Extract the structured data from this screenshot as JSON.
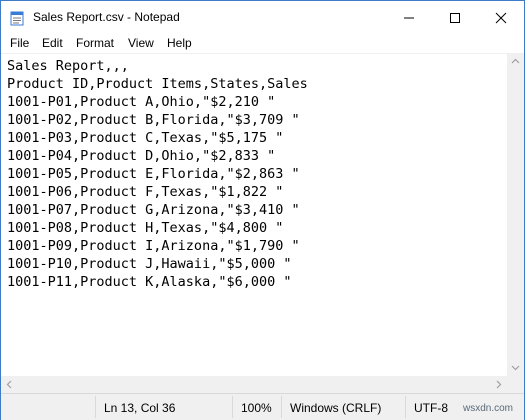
{
  "window": {
    "title": "Sales Report.csv - Notepad"
  },
  "menu": {
    "items": [
      "File",
      "Edit",
      "Format",
      "View",
      "Help"
    ]
  },
  "editor": {
    "lines": [
      "Sales Report,,,",
      "Product ID,Product Items,States,Sales",
      "1001-P01,Product A,Ohio,\"$2,210 \"",
      "1001-P02,Product B,Florida,\"$3,709 \"",
      "1001-P03,Product C,Texas,\"$5,175 \"",
      "1001-P04,Product D,Ohio,\"$2,833 \"",
      "1001-P05,Product E,Florida,\"$2,863 \"",
      "1001-P06,Product F,Texas,\"$1,822 \"",
      "1001-P07,Product G,Arizona,\"$3,410 \"",
      "1001-P08,Product H,Texas,\"$4,800 \"",
      "1001-P09,Product I,Arizona,\"$1,790 \"",
      "1001-P10,Product J,Hawaii,\"$5,000 \"",
      "1001-P11,Product K,Alaska,\"$6,000 \""
    ]
  },
  "status": {
    "position": "Ln 13, Col 36",
    "zoom": "100%",
    "line_ending": "Windows (CRLF)",
    "encoding": "UTF-8"
  },
  "watermark": "wsxdn.com",
  "colors": {
    "border": "#3d7bc7",
    "chrome": "#f0f0f0"
  }
}
